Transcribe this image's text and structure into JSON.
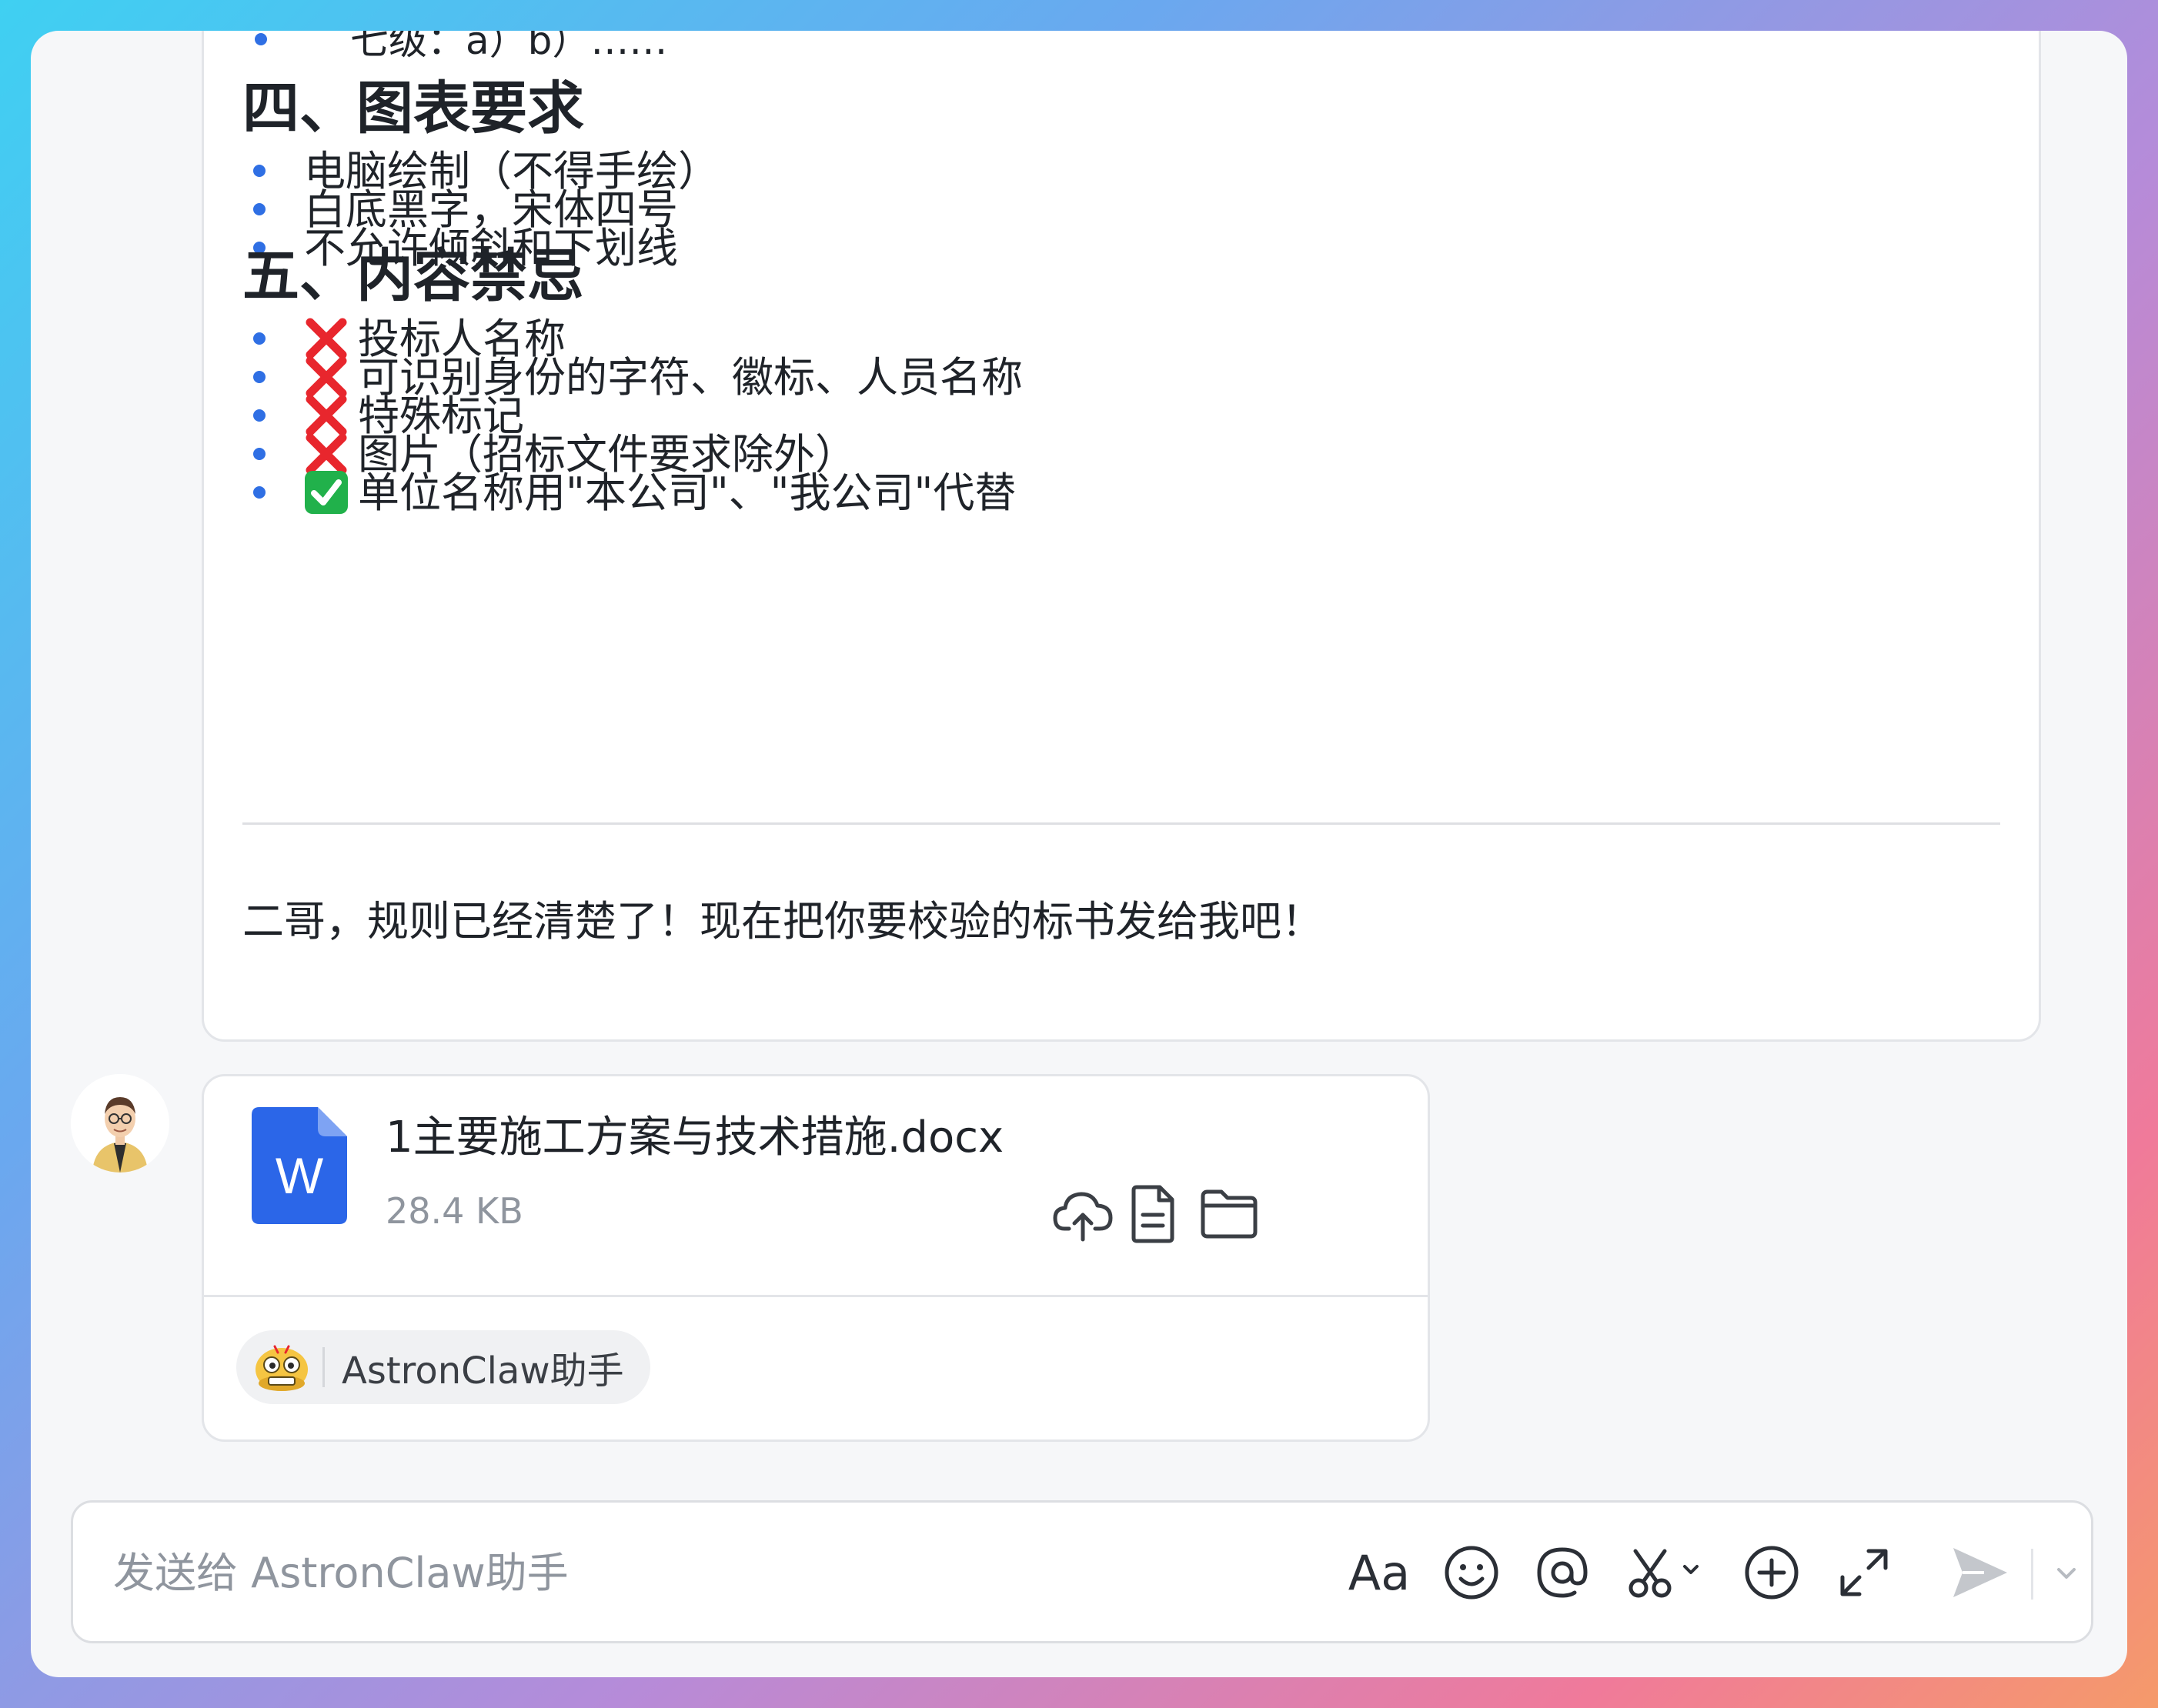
{
  "message": {
    "cut_line": "七级：a）b）……",
    "section4": {
      "title": "四、图表要求",
      "items": [
        "电脑绘制（不得手绘）",
        "白底黑字，宋体四号",
        "不允许倾斜和下划线"
      ]
    },
    "section5": {
      "title": "五、内容禁忌",
      "items": [
        {
          "icon": "cross-mark-icon",
          "text": "投标人名称"
        },
        {
          "icon": "cross-mark-icon",
          "text": "可识别身份的字符、徽标、人员名称"
        },
        {
          "icon": "cross-mark-icon",
          "text": "特殊标记"
        },
        {
          "icon": "cross-mark-icon",
          "text": "图片（招标文件要求除外）"
        },
        {
          "icon": "check-mark-icon",
          "text": "单位名称用\"本公司\"、\"我公司\"代替"
        }
      ]
    },
    "closing": "二哥，规则已经清楚了！现在把你要校验的标书发给我吧！"
  },
  "file": {
    "name": "1主要施工方案与技术措施.docx",
    "size": "28.4 KB",
    "icon_letter": "W"
  },
  "bot_chip": {
    "name": "AstronClaw助手"
  },
  "composer": {
    "placeholder": "发送给 AstronClaw助手",
    "font_button": "Aa"
  },
  "colors": {
    "accent_blue": "#2f6fe4",
    "word_blue": "#2b66e8",
    "cross_red": "#e8262d",
    "check_green": "#21b14b"
  }
}
